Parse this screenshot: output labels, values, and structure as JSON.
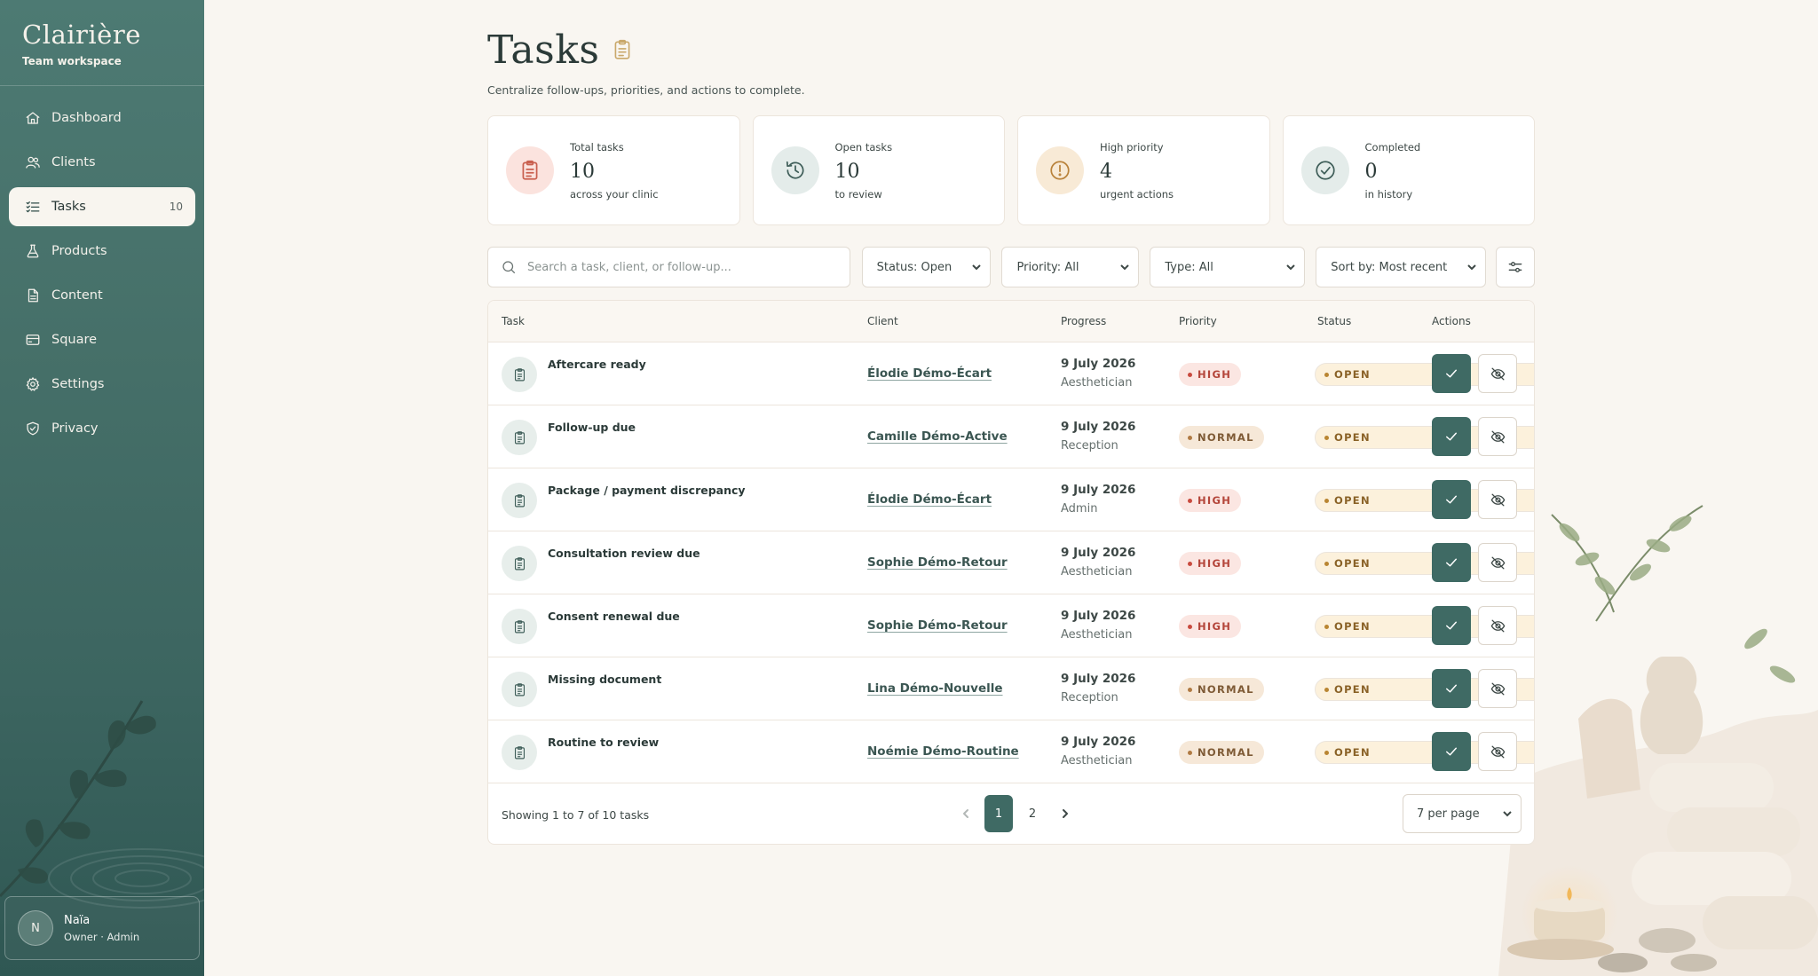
{
  "brand": {
    "name": "Clairière",
    "subtitle": "Team workspace"
  },
  "nav": [
    {
      "label": "Dashboard",
      "icon": "home-icon"
    },
    {
      "label": "Clients",
      "icon": "users-icon"
    },
    {
      "label": "Tasks",
      "icon": "checklist-icon",
      "badge": "10",
      "active": true
    },
    {
      "label": "Products",
      "icon": "flask-icon"
    },
    {
      "label": "Content",
      "icon": "document-icon"
    },
    {
      "label": "Square",
      "icon": "card-icon"
    },
    {
      "label": "Settings",
      "icon": "gear-icon"
    },
    {
      "label": "Privacy",
      "icon": "shield-icon"
    }
  ],
  "user": {
    "initial": "N",
    "name": "Naïa",
    "role": "Owner · Admin"
  },
  "page": {
    "title": "Tasks",
    "subtitle": "Centralize follow-ups, priorities, and actions to complete."
  },
  "stats": [
    {
      "label": "Total tasks",
      "value": "10",
      "note": "across your clinic",
      "icon": "clipboard-icon",
      "color": "#c9604f",
      "bg": "#fbe3de"
    },
    {
      "label": "Open tasks",
      "value": "10",
      "note": "to review",
      "icon": "history-icon",
      "color": "#3f5e59",
      "bg": "#e4ecea"
    },
    {
      "label": "High priority",
      "value": "4",
      "note": "urgent actions",
      "icon": "alert-icon",
      "color": "#b9823a",
      "bg": "#f8ead6"
    },
    {
      "label": "Completed",
      "value": "0",
      "note": "in history",
      "icon": "check-circle-icon",
      "color": "#3f5e59",
      "bg": "#e4ecea"
    }
  ],
  "search": {
    "placeholder": "Search a task, client, or follow-up..."
  },
  "filters": {
    "status": "Status: Open",
    "priority": "Priority: All",
    "type": "Type: All",
    "sort": "Sort by: Most recent"
  },
  "table": {
    "headers": {
      "task": "Task",
      "client": "Client",
      "progress": "Progress",
      "priority": "Priority",
      "status": "Status",
      "actions": "Actions"
    },
    "rows": [
      {
        "task": "Aftercare ready",
        "client": "Élodie Démo-Écart",
        "date": "9 July 2026",
        "role": "Aesthetician",
        "priority": "HIGH",
        "status": "OPEN"
      },
      {
        "task": "Follow-up due",
        "client": "Camille Démo-Active",
        "date": "9 July 2026",
        "role": "Reception",
        "priority": "NORMAL",
        "status": "OPEN"
      },
      {
        "task": "Package / payment discrepancy",
        "client": "Élodie Démo-Écart",
        "date": "9 July 2026",
        "role": "Admin",
        "priority": "HIGH",
        "status": "OPEN"
      },
      {
        "task": "Consultation review due",
        "client": "Sophie Démo-Retour",
        "date": "9 July 2026",
        "role": "Aesthetician",
        "priority": "HIGH",
        "status": "OPEN"
      },
      {
        "task": "Consent renewal due",
        "client": "Sophie Démo-Retour",
        "date": "9 July 2026",
        "role": "Aesthetician",
        "priority": "HIGH",
        "status": "OPEN"
      },
      {
        "task": "Missing document",
        "client": "Lina Démo-Nouvelle",
        "date": "9 July 2026",
        "role": "Reception",
        "priority": "NORMAL",
        "status": "OPEN"
      },
      {
        "task": "Routine to review",
        "client": "Noémie Démo-Routine",
        "date": "9 July 2026",
        "role": "Aesthetician",
        "priority": "NORMAL",
        "status": "OPEN"
      }
    ]
  },
  "footer": {
    "showing": "Showing 1 to 7 of 10 tasks",
    "pages": [
      "1",
      "2"
    ],
    "current_page": "1",
    "per_page": "7 per page"
  },
  "colors": {
    "accent": "#3f6a64",
    "sidebar": "#467069",
    "background": "#f9f6f1"
  }
}
